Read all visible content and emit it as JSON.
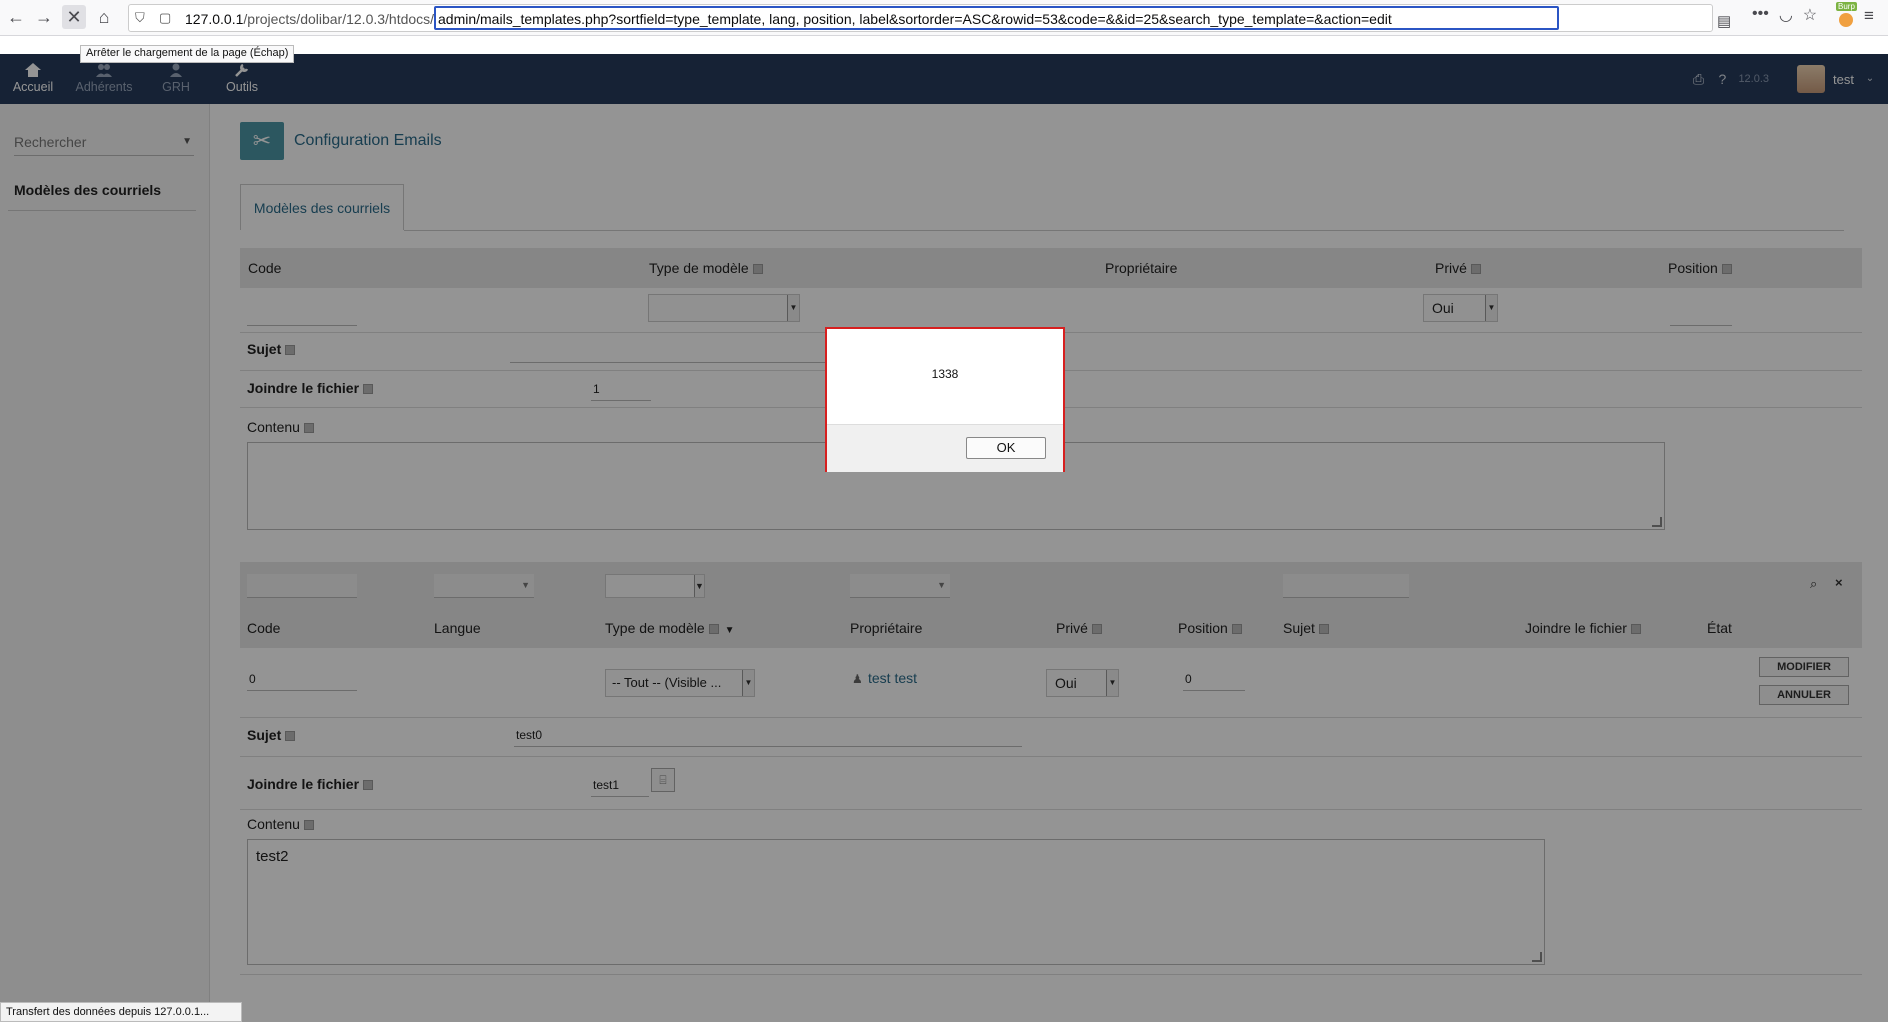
{
  "browser": {
    "url_prefix_host": "127.0.0.1",
    "url_prefix_path": "/projects/dolibar/12.0.3/htdocs/",
    "url_selected": "admin/mails_templates.php?sortfield=type_template, lang, position, label&sortorder=ASC&rowid=53&code=&&id=25&search_type_template=&action=edit",
    "tooltip": "Arrêter le chargement de la page (Échap)",
    "status": "Transfert des données depuis 127.0.0.1...",
    "burp_tag": "Burp"
  },
  "topbar": {
    "items": [
      {
        "label": "Accueil",
        "icon": "home-icon"
      },
      {
        "label": "Adhérents",
        "icon": "members-icon"
      },
      {
        "label": "GRH",
        "icon": "hrm-icon"
      },
      {
        "label": "Outils",
        "icon": "tools-icon"
      }
    ],
    "version": "12.0.3",
    "user": "test"
  },
  "sidebar": {
    "search_placeholder": "Rechercher",
    "link": "Modèles des courriels"
  },
  "page": {
    "title": "Configuration Emails",
    "tab": "Modèles des courriels"
  },
  "form_new": {
    "columns": [
      "Code",
      "Type de modèle",
      "Propriétaire",
      "Privé",
      "Position"
    ],
    "prive_value": "Oui",
    "sujet_label": "Sujet",
    "joindre_label": "Joindre le fichier",
    "joindre_value": "1",
    "contenu_label": "Contenu"
  },
  "form_edit": {
    "columns": [
      "Code",
      "Langue",
      "Type de modèle",
      "Propriétaire",
      "Privé",
      "Position",
      "Sujet",
      "Joindre le fichier",
      "État"
    ],
    "code_value": "0",
    "type_value": "-- Tout -- (Visible ...",
    "owner": "test test",
    "prive_value": "Oui",
    "position_value": "0",
    "modify_btn": "MODIFIER",
    "cancel_btn": "ANNULER",
    "sujet_label": "Sujet",
    "sujet_value": "test0",
    "joindre_label": "Joindre le fichier",
    "joindre_value": "test1",
    "contenu_label": "Contenu",
    "contenu_value": "test2"
  },
  "dialog": {
    "message": "1338",
    "ok": "OK"
  },
  "colors": {
    "topbar": "#263c5c",
    "accent": "#2a6b8a",
    "dialog_border": "#d72020"
  }
}
